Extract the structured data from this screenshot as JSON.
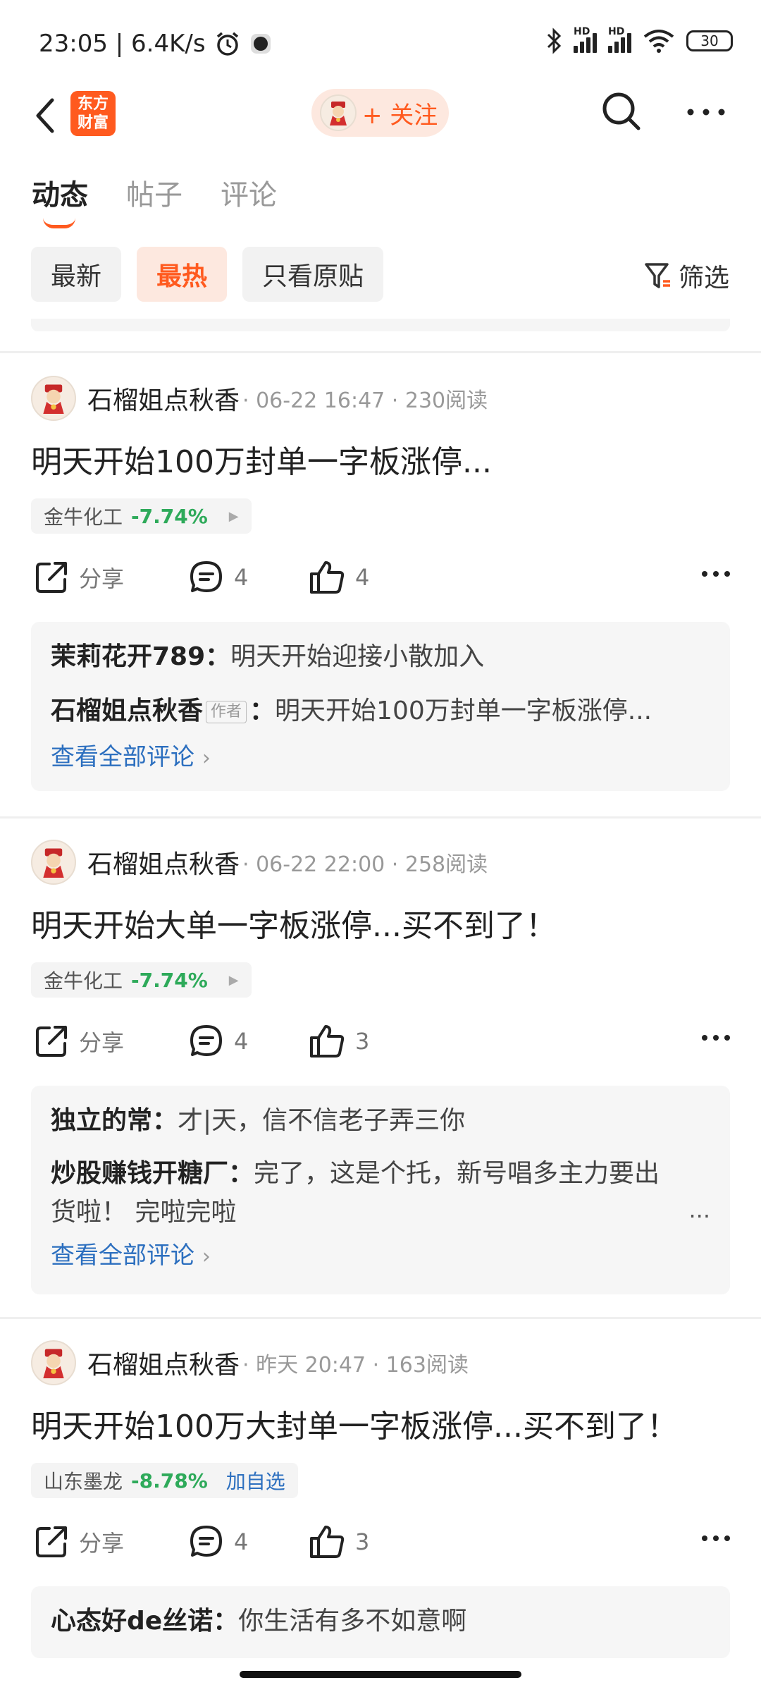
{
  "status_bar": {
    "time_speed": "23:05 | 6.4K/s",
    "battery": "30",
    "hd1": "HD",
    "hd2": "HD"
  },
  "header": {
    "logo_line1": "东方",
    "logo_line2": "财富",
    "follow_label": "+ 关注"
  },
  "tabs": [
    {
      "label": "动态",
      "active": true
    },
    {
      "label": "帖子",
      "active": false
    },
    {
      "label": "评论",
      "active": false
    }
  ],
  "filters": {
    "items": [
      {
        "label": "最新",
        "active": false
      },
      {
        "label": "最热",
        "active": true
      },
      {
        "label": "只看原贴",
        "active": false
      }
    ],
    "screen_label": "筛选"
  },
  "posts": [
    {
      "author": "石榴姐点秋香",
      "meta": "· 06-22 16:47 · 230阅读",
      "title": "明天开始100万封单一字板涨停...",
      "stock_name": "金牛化工",
      "stock_change": "-7.74%",
      "share_label": "分享",
      "comment_count": "4",
      "like_count": "4",
      "comments": [
        {
          "user": "茉莉花开789",
          "text": "明天开始迎接小散加入"
        },
        {
          "user": "石榴姐点秋香",
          "tag": "作者",
          "text": "明天开始100万封单一字板涨停..."
        }
      ],
      "view_all": "查看全部评论"
    },
    {
      "author": "石榴姐点秋香",
      "meta": "· 06-22 22:00 · 258阅读",
      "title": "明天开始大单一字板涨停...买不到了！",
      "stock_name": "金牛化工",
      "stock_change": "-7.74%",
      "share_label": "分享",
      "comment_count": "4",
      "like_count": "3",
      "comments": [
        {
          "user": "独立的常",
          "text": "才|天，信不信老子弄三你"
        },
        {
          "user": "炒股赚钱开糖厂",
          "text": "完了，这是个托，新号唱多主力要出货啦！ 完啦完啦"
        }
      ],
      "view_all": "查看全部评论"
    },
    {
      "author": "石榴姐点秋香",
      "meta": "· 昨天 20:47 · 163阅读",
      "title": "明天开始100万大封单一字板涨停...买不到了！",
      "stock_name": "山东墨龙",
      "stock_change": "-8.78%",
      "stock_add": "加自选",
      "share_label": "分享",
      "comment_count": "4",
      "like_count": "3",
      "comments": [
        {
          "user": "心态好de丝诺",
          "text": "你生活有多不如意啊"
        }
      ]
    }
  ],
  "colors": {
    "accent": "#ff5a1f",
    "down_green": "#2eaa5a",
    "link_blue": "#2c6fbf"
  }
}
